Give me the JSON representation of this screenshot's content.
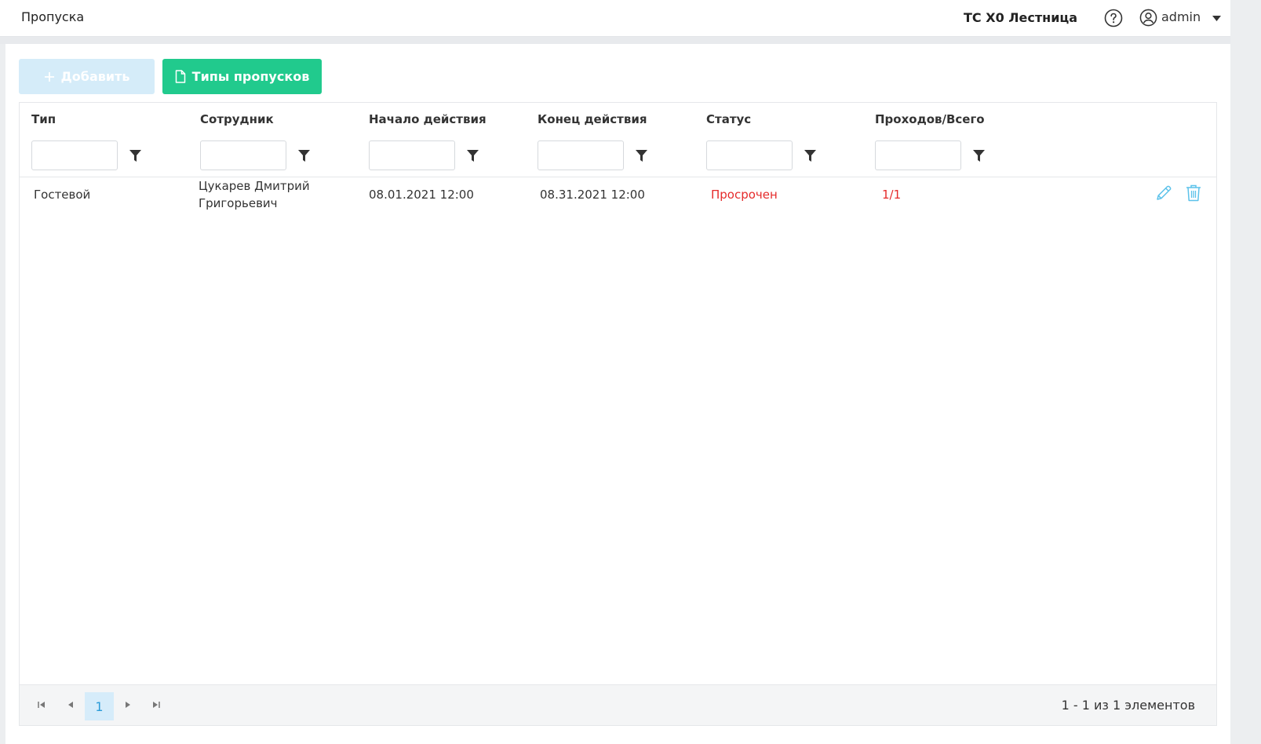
{
  "header": {
    "title": "Пропуска",
    "organization": "ТС Х0 Лестница",
    "user": "admin"
  },
  "toolbar": {
    "add_label": "Добавить",
    "types_label": "Типы пропусков"
  },
  "grid": {
    "columns": [
      "Тип",
      "Сотрудник",
      "Начало действия",
      "Конец действия",
      "Статус",
      "Проходов/Всего"
    ],
    "rows": [
      {
        "type": "Гостевой",
        "employee_line1": "Цукарев Дмитрий",
        "employee_line2": "Григорьевич",
        "start": "08.01.2021 12:00",
        "end": "08.31.2021 12:00",
        "status": "Просрочен",
        "passes": "1/1"
      }
    ]
  },
  "pager": {
    "current_page": "1",
    "info": "1 - 1 из 1 элементов"
  },
  "colors": {
    "accent_green": "#21ca8d",
    "add_disabled": "#d5ecf9",
    "status_red": "#e52b2b",
    "icon_blue": "#5cc2ea"
  }
}
